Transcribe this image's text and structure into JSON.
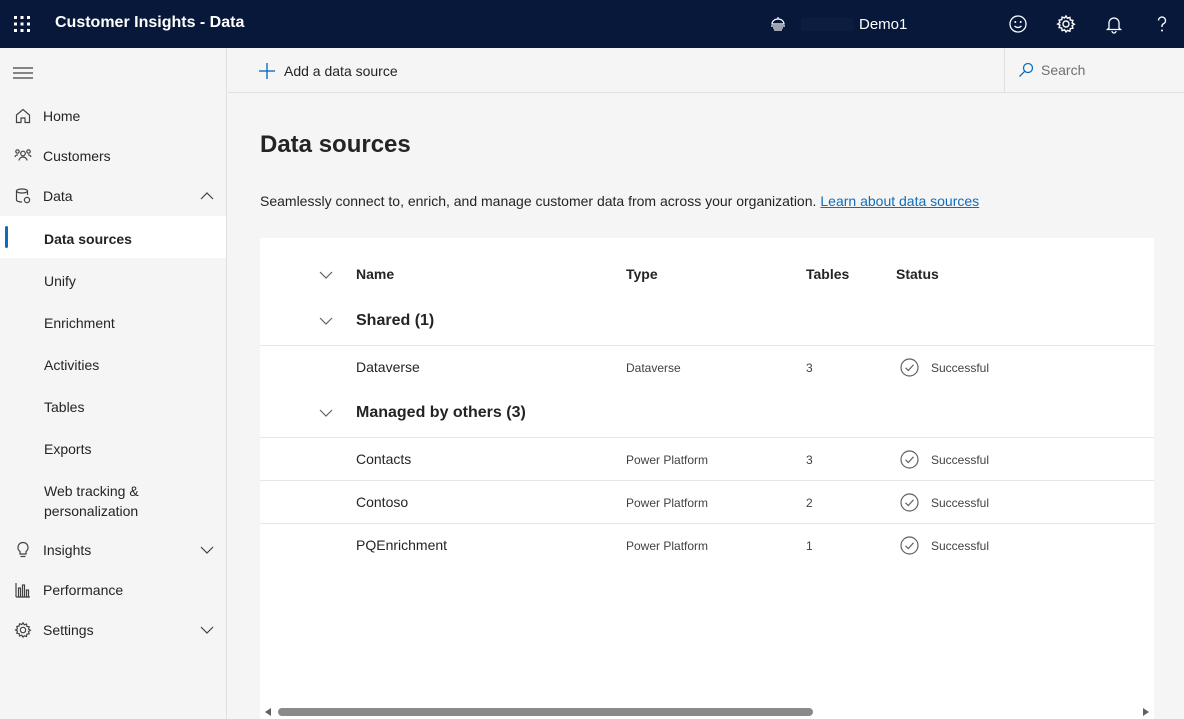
{
  "app": {
    "title": "Customer Insights - Data",
    "environment": "Demo1"
  },
  "nav": {
    "items": [
      {
        "label": "Home"
      },
      {
        "label": "Customers"
      },
      {
        "label": "Data"
      },
      {
        "label": "Insights"
      },
      {
        "label": "Performance"
      },
      {
        "label": "Settings"
      }
    ],
    "data_children": [
      {
        "label": "Data sources",
        "selected": true
      },
      {
        "label": "Unify"
      },
      {
        "label": "Enrichment"
      },
      {
        "label": "Activities"
      },
      {
        "label": "Tables"
      },
      {
        "label": "Exports"
      },
      {
        "label": "Web tracking & personalization"
      }
    ]
  },
  "commandbar": {
    "add_label": "Add a data source",
    "search_placeholder": "Search"
  },
  "page": {
    "title": "Data sources",
    "description": "Seamlessly connect to, enrich, and manage customer data from across your organization.",
    "link": "Learn about data sources"
  },
  "table": {
    "columns": [
      "Name",
      "Type",
      "Tables",
      "Status"
    ],
    "groups": [
      {
        "label": "Shared (1)",
        "rows": [
          {
            "name": "Dataverse",
            "type": "Dataverse",
            "tables": "3",
            "status": "Successful"
          }
        ]
      },
      {
        "label": "Managed by others (3)",
        "rows": [
          {
            "name": "Contacts",
            "type": "Power Platform",
            "tables": "3",
            "status": "Successful"
          },
          {
            "name": "Contoso",
            "type": "Power Platform",
            "tables": "2",
            "status": "Successful"
          },
          {
            "name": "PQEnrichment",
            "type": "Power Platform",
            "tables": "1",
            "status": "Successful"
          }
        ]
      }
    ]
  },
  "colors": {
    "topbar": "#07183a",
    "accent": "#0f6cbd",
    "background": "#f5f5f5"
  },
  "icons": {
    "topbar": [
      "waffle-icon",
      "environment-icon",
      "feedback-smiley-icon",
      "settings-gear-icon",
      "notifications-bell-icon",
      "help-icon"
    ],
    "nav": [
      "home-icon",
      "customers-icon",
      "database-icon",
      "lightbulb-icon",
      "bar-chart-icon",
      "gear-icon"
    ]
  }
}
